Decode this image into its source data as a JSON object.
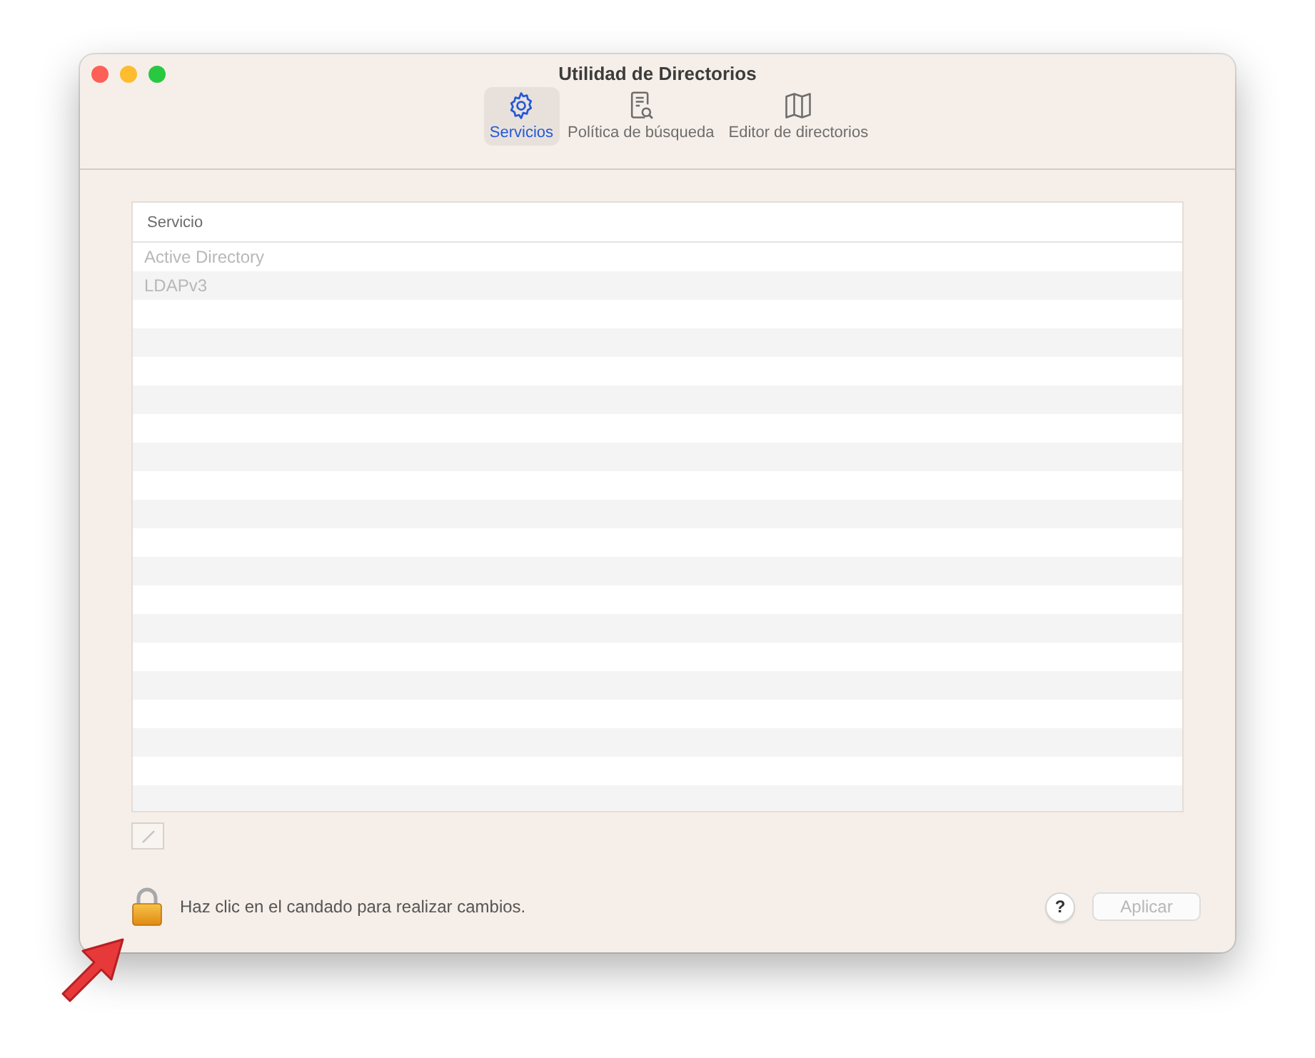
{
  "window": {
    "title": "Utilidad de Directorios"
  },
  "tabs": [
    {
      "label": "Servicios",
      "selected": true
    },
    {
      "label": "Política de búsqueda",
      "selected": false
    },
    {
      "label": "Editor de directorios",
      "selected": false
    }
  ],
  "table": {
    "columns": [
      "Servicio"
    ],
    "rows": [
      {
        "name": "Active Directory",
        "disabled": true
      },
      {
        "name": "LDAPv3",
        "disabled": true
      }
    ]
  },
  "edit_button": {
    "disabled": true
  },
  "lock": {
    "locked": true,
    "message": "Haz clic en el candado para realizar cambios."
  },
  "help_button": {
    "label": "?"
  },
  "apply_button": {
    "label": "Aplicar",
    "disabled": true
  }
}
